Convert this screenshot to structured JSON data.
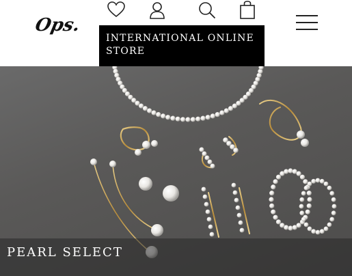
{
  "header": {
    "logo": "Ops.",
    "icons": [
      "heart-icon",
      "user-icon",
      "search-icon",
      "shopping-bag-icon"
    ],
    "menu_icon": "hamburger-menu-icon",
    "store_banner": "INTERNATIONAL ONLINE STORE"
  },
  "hero": {
    "title": "PEARL SELECT"
  },
  "colors": {
    "text": "#111111",
    "banner_bg": "#000000",
    "banner_text": "#ffffff",
    "hero_bg": "#5a5958"
  }
}
